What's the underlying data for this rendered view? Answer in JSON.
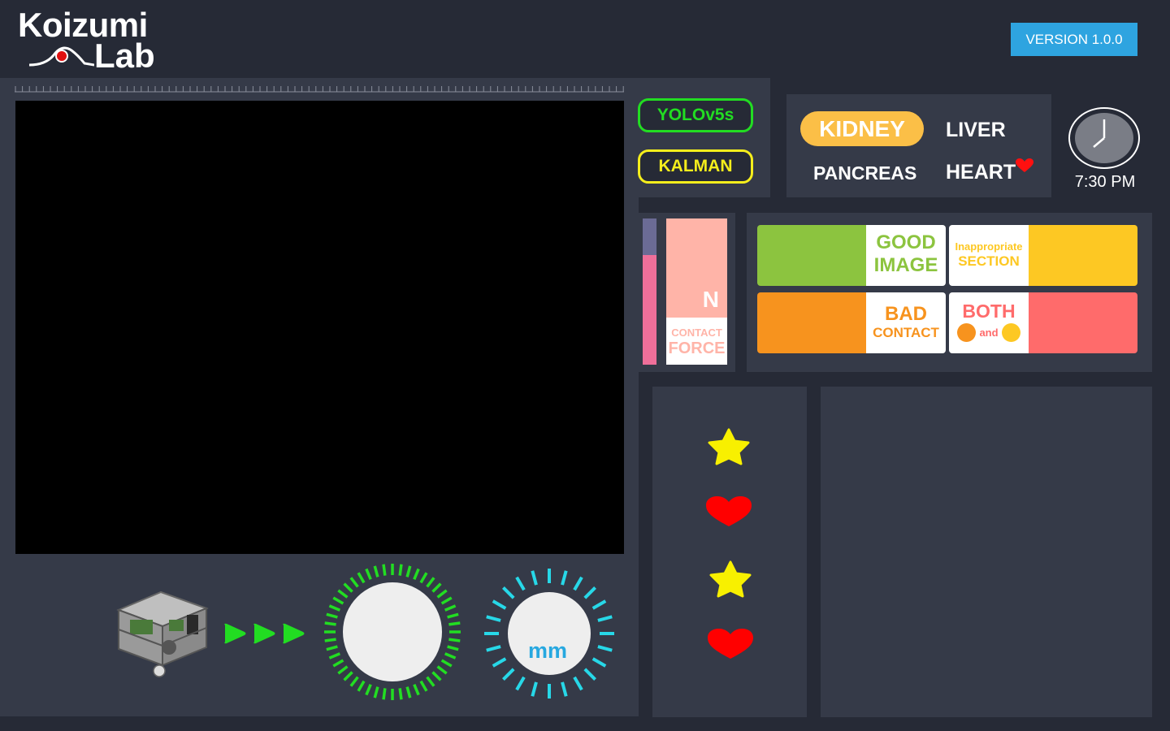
{
  "logo": {
    "line1": "Koizumi",
    "line2": "Lab"
  },
  "version": {
    "label": "VERSION 1.0.0",
    "color": "#2ea4e0"
  },
  "models": [
    {
      "label": "YOLOv5s",
      "color": "#22dd22"
    },
    {
      "label": "KALMAN",
      "color": "#f5ee1c"
    }
  ],
  "organs": {
    "selected": "KIDNEY",
    "items": [
      "KIDNEY",
      "LIVER",
      "PANCREAS",
      "HEART"
    ],
    "heart_marker_icon": "heart-icon"
  },
  "clock": {
    "time": "7:30 PM",
    "icon": "clock-icon"
  },
  "force": {
    "unit": "N",
    "label_line1": "CONTACT",
    "label_line2": "FORCE",
    "level_fraction": 0.75
  },
  "status": {
    "good_image": {
      "line1": "GOOD",
      "line2": "IMAGE",
      "color": "#8cc43f"
    },
    "inappropriate": {
      "line1": "Inappropriate",
      "line2": "SECTION",
      "color": "#fdc823"
    },
    "bad_contact": {
      "line1": "BAD",
      "line2": "CONTACT",
      "color": "#f7931e"
    },
    "both": {
      "line1": "BOTH",
      "and": "and",
      "color": "#ff6b6b"
    }
  },
  "markers": [
    {
      "icon": "star-icon",
      "color": "#f8f000"
    },
    {
      "icon": "heart-icon",
      "color": "#ff0000"
    },
    {
      "icon": "star-icon",
      "color": "#f8f000"
    },
    {
      "icon": "heart-icon",
      "color": "#ff0000"
    }
  ],
  "probe": {
    "icon": "robot-device-icon",
    "arrows_icon": "play-arrows-icon",
    "speed_dial_color": "#22dd22",
    "distance_dial": {
      "unit": "mm",
      "color": "#27d8e8"
    }
  }
}
